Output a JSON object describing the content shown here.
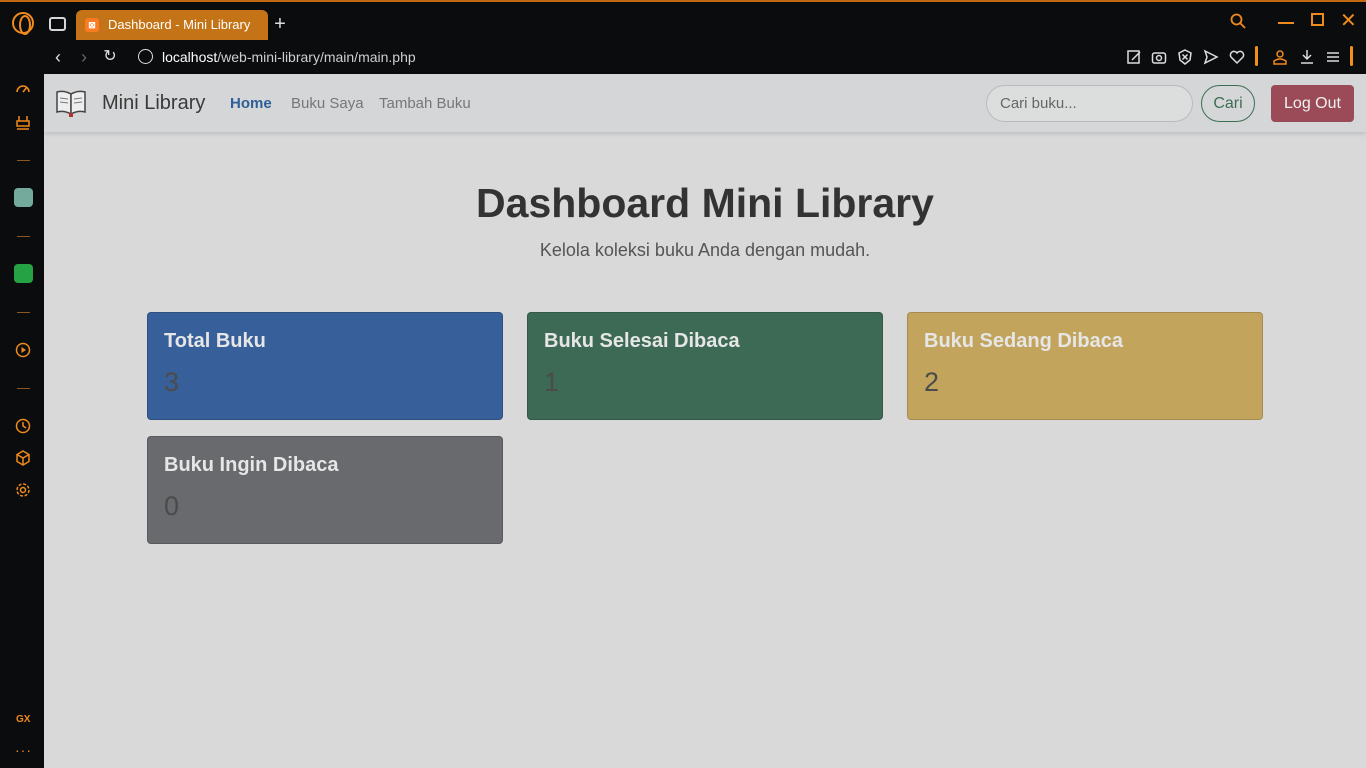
{
  "browser": {
    "tab_title": "Dashboard - Mini Library",
    "url_host": "localhost",
    "url_path": "/web-mini-library/main/main.php",
    "new_tab_symbol": "+"
  },
  "sidebar": {
    "gx_label": "GX",
    "more_label": "···"
  },
  "navbar": {
    "brand": "Mini Library",
    "links": [
      {
        "label": "Home",
        "active": true
      },
      {
        "label": "Buku Saya"
      },
      {
        "label": "Tambah Buku"
      }
    ],
    "search_placeholder": "Cari buku...",
    "search_button": "Cari",
    "logout_button": "Log Out"
  },
  "hero": {
    "title": "Dashboard Mini Library",
    "subtitle": "Kelola koleksi buku Anda dengan mudah."
  },
  "cards": [
    {
      "title": "Total Buku",
      "value": "3",
      "color": "#375f99"
    },
    {
      "title": "Buku Selesai Dibaca",
      "value": "1",
      "color": "#3d6a55"
    },
    {
      "title": "Buku Sedang Dibaca",
      "value": "2",
      "color": "#c2a45c"
    },
    {
      "title": "Buku Ingin Dibaca",
      "value": "0",
      "color": "#686a6d"
    }
  ],
  "colors": {
    "accent": "#f08a1c",
    "tab": "#c47416",
    "home_link": "#2f5f98",
    "logout": "#9a4b57"
  }
}
